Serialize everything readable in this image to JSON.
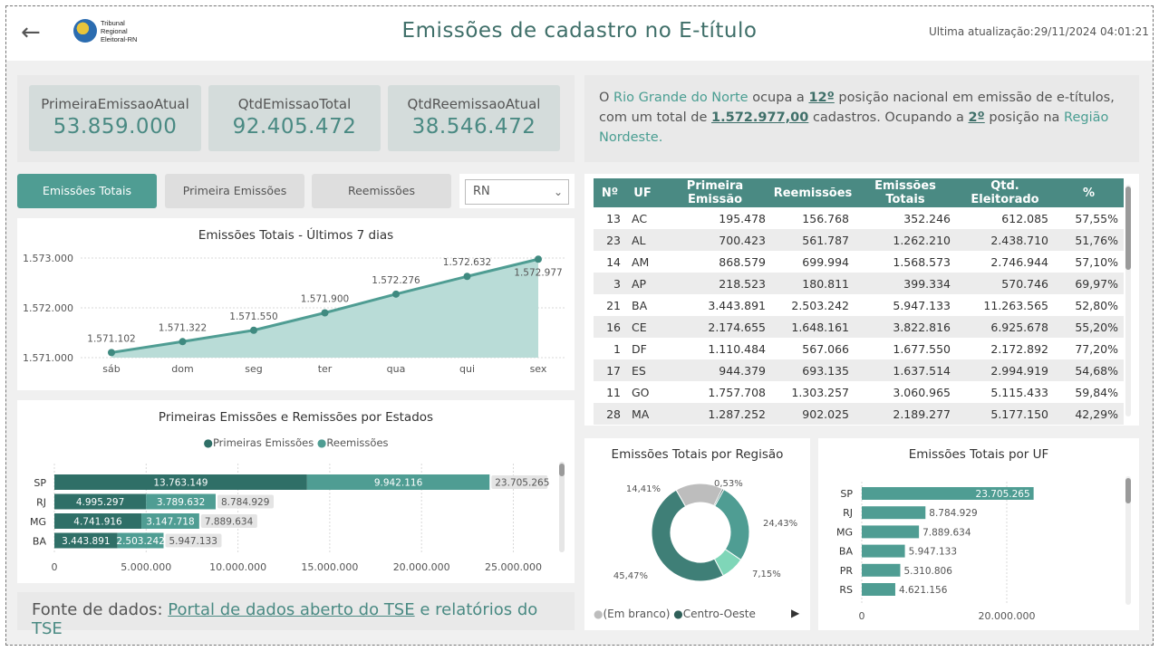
{
  "header": {
    "title": "Emissões de cadastro  no E-título",
    "logo_text": [
      "Tribunal",
      "Regional",
      "Eleitoral-RN"
    ],
    "update_label": "Ultima atualização:",
    "update_value": "29/11/2024 04:01:21"
  },
  "kpis": [
    {
      "label": "PrimeiraEmissaoAtual",
      "value": "53.859.000"
    },
    {
      "label": "QtdEmissaoTotal",
      "value": "92.405.472"
    },
    {
      "label": "QtdReemissaoAtual",
      "value": "38.546.472"
    }
  ],
  "info": {
    "p1": "O ",
    "state": "Rio Grande do Norte",
    "p2": " ocupa a ",
    "rank": "12º",
    "p3": " posição nacional em emissão de e-títulos, com um total de ",
    "total": "1.572.977,00",
    "p4": " cadastros. Ocupando a ",
    "region_rank": "2º",
    "p5": " posição na ",
    "region": "Região Nordeste."
  },
  "tabs": [
    "Emissões Totais",
    "Primeira Emissões",
    "Reemissões"
  ],
  "dropdown": {
    "value": "RN"
  },
  "line_chart": {
    "title": "Emissões Totais - Últimos 7 dias",
    "y_ticks": [
      "1.573.000",
      "1.572.000",
      "1.571.000"
    ]
  },
  "bar_chart": {
    "title": "Primeiras Emissões e Remissões por Estados",
    "legend": [
      "Primeiras Emissões",
      "Reemissões"
    ],
    "x_ticks": [
      "0",
      "5.000.000",
      "10.000.000",
      "15.000.000",
      "20.000.000",
      "25.000.000"
    ]
  },
  "table": {
    "headers": [
      "Nº",
      "UF",
      "Primeira Emissão",
      "Reemissões",
      "Emissões Totais",
      "Qtd. Eleitorado",
      "%"
    ],
    "rows": [
      [
        "13",
        "AC",
        "195.478",
        "156.768",
        "352.246",
        "612.085",
        "57,55%"
      ],
      [
        "23",
        "AL",
        "700.423",
        "561.787",
        "1.262.210",
        "2.438.710",
        "51,76%"
      ],
      [
        "14",
        "AM",
        "868.579",
        "699.994",
        "1.568.573",
        "2.746.944",
        "57,10%"
      ],
      [
        "3",
        "AP",
        "218.523",
        "180.811",
        "399.334",
        "570.746",
        "69,97%"
      ],
      [
        "21",
        "BA",
        "3.443.891",
        "2.503.242",
        "5.947.133",
        "11.263.565",
        "52,80%"
      ],
      [
        "16",
        "CE",
        "2.174.655",
        "1.648.161",
        "3.822.816",
        "6.925.678",
        "55,20%"
      ],
      [
        "1",
        "DF",
        "1.110.484",
        "567.066",
        "1.677.550",
        "2.172.892",
        "77,20%"
      ],
      [
        "17",
        "ES",
        "944.379",
        "693.135",
        "1.637.514",
        "2.994.919",
        "54,68%"
      ],
      [
        "11",
        "GO",
        "1.757.708",
        "1.303.257",
        "3.060.965",
        "5.115.433",
        "59,84%"
      ],
      [
        "28",
        "MA",
        "1.287.252",
        "902.025",
        "2.189.277",
        "5.177.150",
        "42,29%"
      ]
    ]
  },
  "donut": {
    "title": "Emissões Totais por Regisão",
    "legend": [
      "(Em branco)",
      "Centro-Oeste"
    ]
  },
  "uf_chart": {
    "title": "Emissões Totais por UF",
    "x_ticks": [
      "0",
      "20.000.000"
    ]
  },
  "footer": {
    "label": "Fonte de dados: ",
    "link": "Portal de dados aberto do TSE",
    "rest": " e relatórios do TSE"
  },
  "colors": {
    "accent": "#4f9d93",
    "dark": "#2f5f59",
    "light": "#a8d5cf",
    "gray": "#bdbdbd",
    "mint": "#7fd6b8"
  },
  "chart_data": [
    {
      "type": "area",
      "title": "Emissões Totais - Últimos 7 dias",
      "categories": [
        "sáb",
        "dom",
        "seg",
        "ter",
        "qua",
        "qui",
        "sex"
      ],
      "values": [
        1571102,
        1571322,
        1571550,
        1571900,
        1572276,
        1572632,
        1572977
      ],
      "labels": [
        "1.571.102",
        "1.571.322",
        "1.571.550",
        "1.571.900",
        "1.572.276",
        "1.572.632",
        "1.572.977"
      ],
      "ylim": [
        1571000,
        1573000
      ]
    },
    {
      "type": "bar",
      "orientation": "horizontal-stacked",
      "title": "Primeiras Emissões e Remissões por Estados",
      "categories": [
        "SP",
        "RJ",
        "MG",
        "BA"
      ],
      "series": [
        {
          "name": "Primeiras Emissões",
          "values": [
            13763149,
            4995297,
            4741916,
            3443891
          ],
          "labels": [
            "13.763.149",
            "4.995.297",
            "4.741.916",
            "3.443.891"
          ]
        },
        {
          "name": "Reemissões",
          "values": [
            9942116,
            3789632,
            3147718,
            2503242
          ],
          "labels": [
            "9.942.116",
            "3.789.632",
            "3.147.718",
            "2.503.242"
          ]
        }
      ],
      "totals": [
        "23.705.265",
        "8.784.929",
        "7.889.634",
        "5.947.133"
      ],
      "xlim": [
        0,
        27000000
      ]
    },
    {
      "type": "pie",
      "title": "Emissões Totais por Regisão",
      "slices": [
        {
          "label": "0,53%",
          "value": 0.53
        },
        {
          "label": "24,43%",
          "value": 24.43
        },
        {
          "label": "7,15%",
          "value": 7.15
        },
        {
          "label": "45,47%",
          "value": 45.47
        },
        {
          "label": "14,41%",
          "value": 14.41
        }
      ],
      "donut": true
    },
    {
      "type": "bar",
      "orientation": "horizontal",
      "title": "Emissões Totais por UF",
      "categories": [
        "SP",
        "RJ",
        "MG",
        "BA",
        "PR",
        "RS"
      ],
      "values": [
        23705265,
        8784929,
        7889634,
        5947133,
        5310806,
        4621156
      ],
      "labels": [
        "23.705.265",
        "8.784.929",
        "7.889.634",
        "5.947.133",
        "5.310.806",
        "4.621.156"
      ],
      "xlim": [
        0,
        35000000
      ]
    }
  ]
}
